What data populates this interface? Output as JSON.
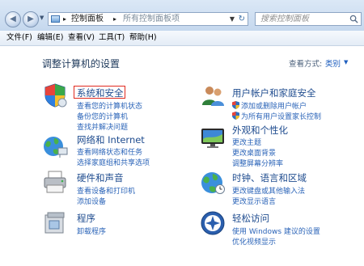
{
  "address_bar": {
    "breadcrumb": [
      "控制面板"
    ],
    "breadcrumb_current": "所有控制面板项",
    "search_placeholder": "搜索控制面板"
  },
  "menu": [
    "文件(F)",
    "编辑(E)",
    "查看(V)",
    "工具(T)",
    "帮助(H)"
  ],
  "main": {
    "title": "调整计算机的设置",
    "view_by_label": "查看方式:",
    "view_by_value": "类别"
  },
  "categories": [
    {
      "id": "system-security",
      "title": "系统和安全",
      "icon": "shield-flag-icon",
      "highlighted": true,
      "links": [
        {
          "text": "查看您的计算机状态",
          "shield": false
        },
        {
          "text": "备份您的计算机",
          "shield": false
        },
        {
          "text": "查找并解决问题",
          "shield": false
        }
      ]
    },
    {
      "id": "user-accounts",
      "title": "用户帐户和家庭安全",
      "icon": "users-icon",
      "highlighted": false,
      "links": [
        {
          "text": "添加或删除用户帐户",
          "shield": true
        },
        {
          "text": "为所有用户设置家长控制",
          "shield": true
        }
      ]
    },
    {
      "id": "network",
      "title": "网络和 Internet",
      "icon": "network-globe-icon",
      "highlighted": false,
      "links": [
        {
          "text": "查看网络状态和任务",
          "shield": false
        },
        {
          "text": "选择家庭组和共享选项",
          "shield": false
        }
      ]
    },
    {
      "id": "appearance",
      "title": "外观和个性化",
      "icon": "monitor-icon",
      "highlighted": false,
      "links": [
        {
          "text": "更改主题",
          "shield": false
        },
        {
          "text": "更改桌面背景",
          "shield": false
        },
        {
          "text": "调整屏幕分辨率",
          "shield": false
        }
      ]
    },
    {
      "id": "hardware",
      "title": "硬件和声音",
      "icon": "printer-icon",
      "highlighted": false,
      "links": [
        {
          "text": "查看设备和打印机",
          "shield": false
        },
        {
          "text": "添加设备",
          "shield": false
        }
      ]
    },
    {
      "id": "clock",
      "title": "时钟、语言和区域",
      "icon": "clock-globe-icon",
      "highlighted": false,
      "links": [
        {
          "text": "更改键盘或其他输入法",
          "shield": false
        },
        {
          "text": "更改显示语言",
          "shield": false
        }
      ]
    },
    {
      "id": "programs",
      "title": "程序",
      "icon": "programs-icon",
      "highlighted": false,
      "links": [
        {
          "text": "卸载程序",
          "shield": false
        }
      ]
    },
    {
      "id": "ease",
      "title": "轻松访问",
      "icon": "ease-of-access-icon",
      "highlighted": false,
      "links": [
        {
          "text": "使用 Windows 建议的设置",
          "shield": false
        },
        {
          "text": "优化视频显示",
          "shield": false
        }
      ]
    }
  ],
  "colors": {
    "link": "#2b64b8",
    "title": "#1f4c8f",
    "highlight": "#e02a1f"
  }
}
